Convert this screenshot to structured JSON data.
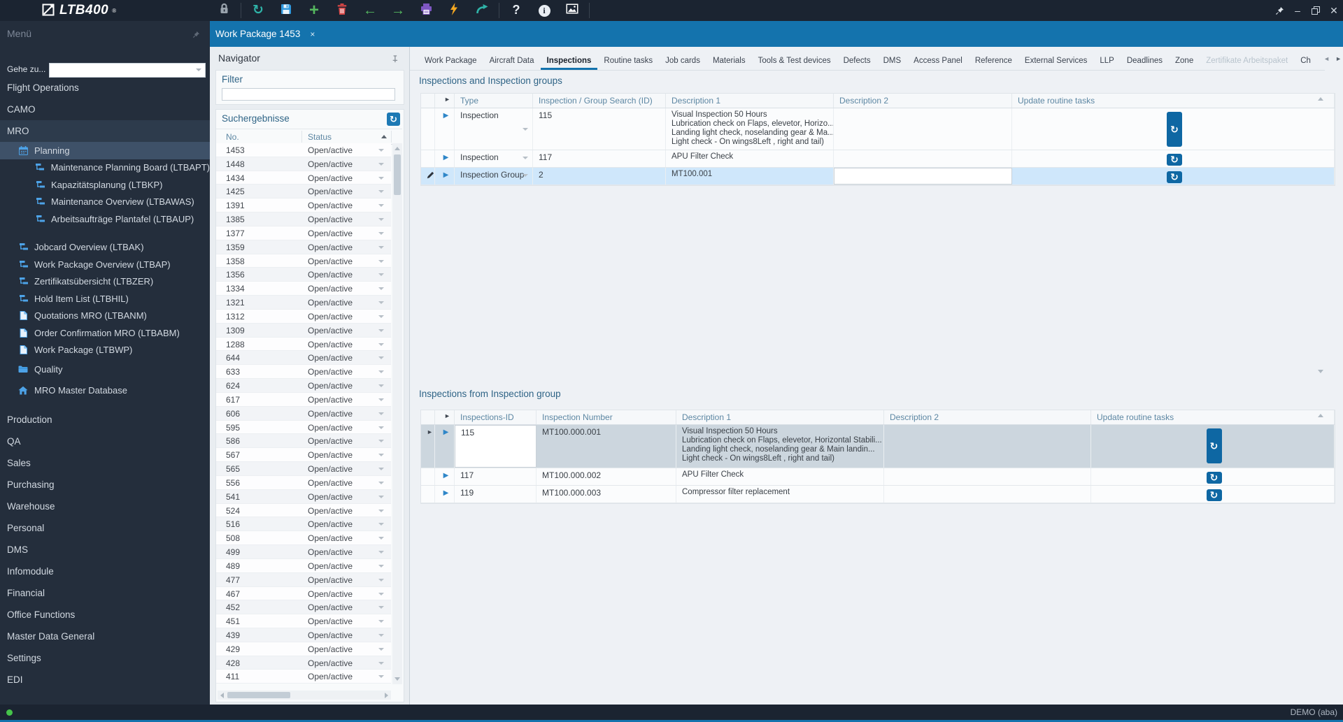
{
  "colors": {
    "accent": "#1473ad",
    "topbar_bg": "#1b2431",
    "sidebar_bg": "#242e3c",
    "selected_row_blue": "#cfe7fb",
    "selected_row_gray": "#ccd6de",
    "button_blue": "#0e67a3",
    "status_green": "#45c34a"
  },
  "topbar": {
    "logo": "LTB400",
    "logo_reg": "®",
    "tools": [
      {
        "name": "lock-button",
        "icon": "lock-icon",
        "group": 1
      },
      {
        "name": "refresh-button",
        "icon": "refresh-icon",
        "group": 2
      },
      {
        "name": "save-button",
        "icon": "save-icon",
        "group": 2
      },
      {
        "name": "add-button",
        "icon": "plus-icon",
        "group": 2
      },
      {
        "name": "delete-button",
        "icon": "trash-icon",
        "group": 2
      },
      {
        "name": "back-button",
        "icon": "arrow-left-icon",
        "group": 2
      },
      {
        "name": "forward-button",
        "icon": "arrow-right-icon",
        "group": 2
      },
      {
        "name": "print-button",
        "icon": "printer-icon",
        "group": 2
      },
      {
        "name": "quick-action-button",
        "icon": "lightning-icon",
        "group": 2
      },
      {
        "name": "redo-button",
        "icon": "redo-icon",
        "group": 2
      },
      {
        "name": "help-button",
        "icon": "help-icon",
        "group": 3
      },
      {
        "name": "info-button",
        "icon": "info-icon",
        "group": 3
      },
      {
        "name": "image-button",
        "icon": "image-icon",
        "group": 3
      }
    ],
    "window_controls": [
      "pin-icon",
      "minimize-icon",
      "restore-icon",
      "close-icon"
    ]
  },
  "sidebar": {
    "menu_title": "Menü",
    "goto_label": "Gehe zu...",
    "goto_value": "",
    "items": [
      {
        "label": "Flight Operations",
        "level": 0
      },
      {
        "label": "CAMO",
        "level": 0
      },
      {
        "label": "MRO",
        "level": 0,
        "state": "section"
      },
      {
        "label": "Planning",
        "level": 1,
        "icon": "calendar-icon",
        "state": "active"
      },
      {
        "label": "Maintenance Planning Board (LTBAPT)",
        "level": 2,
        "icon": "flowchart-icon"
      },
      {
        "label": "Kapazitätsplanung (LTBKP)",
        "level": 2,
        "icon": "flowchart-icon"
      },
      {
        "label": "Maintenance Overview (LTBAWAS)",
        "level": 2,
        "icon": "flowchart-icon"
      },
      {
        "label": "Arbeitsaufträge Plantafel (LTBAUP)",
        "level": 2,
        "icon": "flowchart-icon"
      },
      {
        "label": "Jobcard Overview (LTBAK)",
        "level": 1,
        "icon": "flowchart-icon",
        "gap": true
      },
      {
        "label": "Work Package Overview (LTBAP)",
        "level": 1,
        "icon": "flowchart-icon"
      },
      {
        "label": "Zertifikatsübersicht (LTBZER)",
        "level": 1,
        "icon": "flowchart-icon"
      },
      {
        "label": "Hold Item List (LTBHIL)",
        "level": 1,
        "icon": "flowchart-icon"
      },
      {
        "label": "Quotations MRO (LTBANM)",
        "level": 1,
        "icon": "document-icon"
      },
      {
        "label": "Order Confirmation MRO (LTBABM)",
        "level": 1,
        "icon": "document-icon"
      },
      {
        "label": "Work Package (LTBWP)",
        "level": 1,
        "icon": "document-icon"
      },
      {
        "label": "Quality",
        "level": 1,
        "icon": "folder-icon",
        "tall": true
      },
      {
        "label": "MRO Master Database",
        "level": 1,
        "icon": "home-icon",
        "tall": true
      },
      {
        "label": "Production",
        "level": 0,
        "gap": true
      },
      {
        "label": "QA",
        "level": 0
      },
      {
        "label": "Sales",
        "level": 0
      },
      {
        "label": "Purchasing",
        "level": 0
      },
      {
        "label": "Warehouse",
        "level": 0
      },
      {
        "label": "Personal",
        "level": 0
      },
      {
        "label": "DMS",
        "level": 0
      },
      {
        "label": "Infomodule",
        "level": 0
      },
      {
        "label": "Financial",
        "level": 0
      },
      {
        "label": "Office Functions",
        "level": 0
      },
      {
        "label": "Master Data General",
        "level": 0
      },
      {
        "label": "Settings",
        "level": 0
      },
      {
        "label": "EDI",
        "level": 0
      }
    ]
  },
  "doc_tab": {
    "label": "Work Package 1453",
    "close": "×"
  },
  "navigator": {
    "title": "Navigator",
    "filter_title": "Filter",
    "results_title": "Suchergebnisse",
    "columns": [
      "No.",
      "Status"
    ],
    "status_value": "Open/active",
    "rows": [
      "1453",
      "1448",
      "1434",
      "1425",
      "1391",
      "1385",
      "1377",
      "1359",
      "1358",
      "1356",
      "1334",
      "1321",
      "1312",
      "1309",
      "1288",
      "644",
      "633",
      "624",
      "617",
      "606",
      "595",
      "586",
      "567",
      "565",
      "556",
      "541",
      "524",
      "516",
      "508",
      "499",
      "489",
      "477",
      "467",
      "452",
      "451",
      "439",
      "429",
      "428",
      "411"
    ]
  },
  "content": {
    "tabs": [
      "Work Package",
      "Aircraft Data",
      "Inspections",
      "Routine tasks",
      "Job cards",
      "Materials",
      "Tools & Test devices",
      "Defects",
      "DMS",
      "Access Panel",
      "Reference",
      "External Services",
      "LLP",
      "Deadlines",
      "Zone",
      "Zertifikate Arbeitspaket",
      "Ch"
    ],
    "active_tab": "Inspections",
    "disabled_tabs": [
      "Zertifikate Arbeitspaket"
    ],
    "section1": {
      "title": "Inspections and Inspection groups",
      "columns": [
        "Type",
        "Inspection / Group Search (ID)",
        "Description 1",
        "Description 2",
        "Update routine tasks"
      ],
      "rows": [
        {
          "type": "Inspection",
          "id": "115",
          "desc1": [
            "Visual Inspection 50 Hours",
            "Lubrication check on Flaps, elevetor, Horizo...",
            "Landing light check, noselanding gear & Ma...",
            "Light check - On wings8Left , right and tail)"
          ],
          "desc2": "",
          "selected": false
        },
        {
          "type": "Inspection",
          "id": "117",
          "desc1": [
            "APU Filter Check"
          ],
          "desc2": "",
          "selected": false
        },
        {
          "type": "Inspection Group",
          "id": "2",
          "desc1": [
            "MT100.001"
          ],
          "desc2": "",
          "selected": true,
          "editing": true
        }
      ]
    },
    "section2": {
      "title": "Inspections from Inspection group",
      "columns": [
        "Inspections-ID",
        "Inspection Number",
        "Description 1",
        "Description 2",
        "Update routine tasks"
      ],
      "rows": [
        {
          "id": "115",
          "number": "MT100.000.001",
          "desc1": [
            "Visual Inspection 50 Hours",
            "Lubrication check on Flaps, elevetor, Horizontal Stabili...",
            "Landing light check, noselanding gear & Main landin...",
            "Light check - On wings8Left , right and tail)"
          ],
          "desc2": "",
          "selected": true,
          "marked": true
        },
        {
          "id": "117",
          "number": "MT100.000.002",
          "desc1": [
            "APU Filter Check"
          ],
          "desc2": "",
          "selected": false
        },
        {
          "id": "119",
          "number": "MT100.000.003",
          "desc1": [
            "Compressor filter replacement"
          ],
          "desc2": "",
          "selected": false
        }
      ]
    }
  },
  "statusbar": {
    "user": "DEMO (aba)"
  }
}
